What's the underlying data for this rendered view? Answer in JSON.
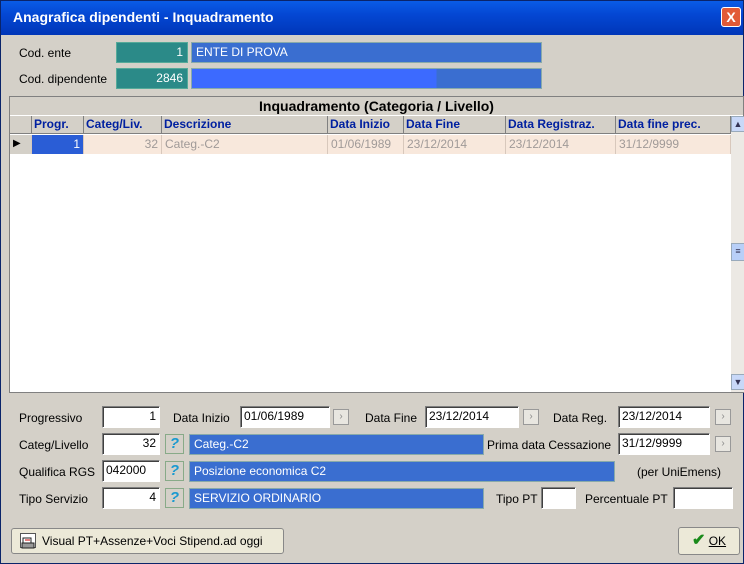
{
  "window": {
    "title": "Anagrafica dipendenti -  Inquadramento",
    "close_label": "X"
  },
  "ente": {
    "label": "Cod. ente",
    "code": "1",
    "name": "ENTE DI PROVA"
  },
  "dipendente": {
    "label": "Cod. dipendente",
    "code": "2846",
    "name": ""
  },
  "grid": {
    "title": "Inquadramento (Categoria / Livello)",
    "columns": [
      "Progr.",
      "Categ/Liv.",
      "Descrizione",
      "Data Inizio",
      "Data Fine",
      "Data Registraz.",
      "Data fine prec."
    ],
    "rows": [
      {
        "progr": "1",
        "categ": "32",
        "descr": "Categ.-C2",
        "inizio": "01/06/1989",
        "fine": "23/12/2014",
        "registraz": "23/12/2014",
        "fineprec": "31/12/9999"
      }
    ]
  },
  "form": {
    "progressivo_label": "Progressivo",
    "progressivo": "1",
    "data_inizio_label": "Data Inizio",
    "data_inizio": "01/06/1989",
    "data_fine_label": "Data Fine",
    "data_fine": "23/12/2014",
    "data_reg_label": "Data Reg.",
    "data_reg": "23/12/2014",
    "categ_label": "Categ/Livello",
    "categ": "32",
    "categ_descr": "Categ.-C2",
    "prima_cess_label": "Prima data Cessazione",
    "prima_cess": "31/12/9999",
    "qualifica_label": "Qualifica RGS",
    "qualifica": "042000",
    "qualifica_descr": "Posizione economica C2",
    "uniemens_label": "(per UniEmens)",
    "tipo_servizio_label": "Tipo Servizio",
    "tipo_servizio": "4",
    "tipo_servizio_descr": "SERVIZIO ORDINARIO",
    "tipo_pt_label": "Tipo PT",
    "tipo_pt": "",
    "perc_pt_label": "Percentuale PT",
    "perc_pt": ""
  },
  "buttons": {
    "visual": "Visual PT+Assenze+Voci Stipend.ad oggi",
    "ok": "OK"
  }
}
